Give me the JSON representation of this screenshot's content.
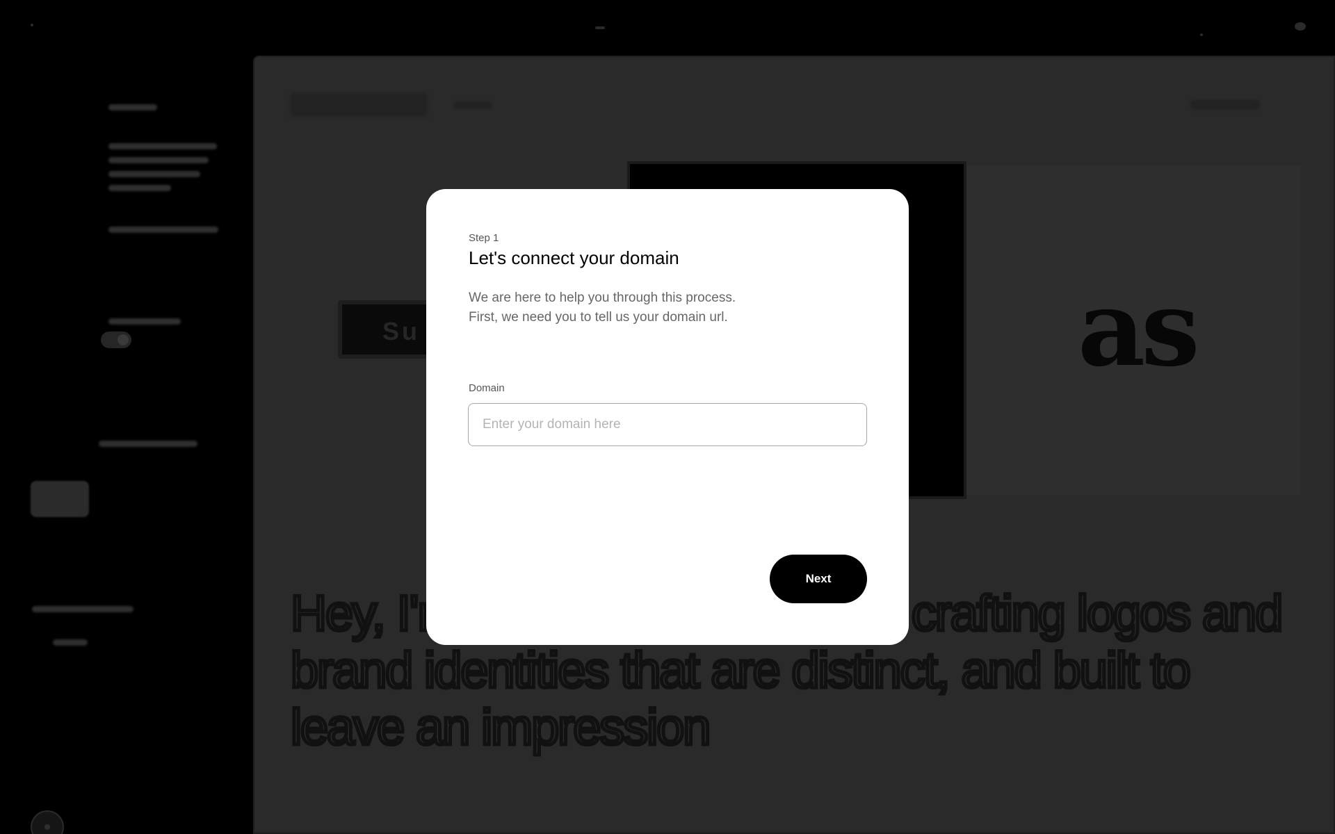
{
  "modal": {
    "step": "Step 1",
    "title": "Let's connect your domain",
    "description_line1": "We are here to help you through this process.",
    "description_line2": "First, we need you to tell us your domain url.",
    "field_label": "Domain",
    "input_value": "",
    "input_placeholder": "Enter your domain here",
    "next_label": "Next"
  },
  "background": {
    "headline": "Hey, I'm ... who specializes in crafting logos and brand identities that are distinct, and built to leave an impression",
    "card_glyph": "as",
    "pill_text": "Su"
  },
  "colors": {
    "overlay_background": "#000000",
    "modal_background": "#ffffff",
    "primary_button": "#000000"
  }
}
